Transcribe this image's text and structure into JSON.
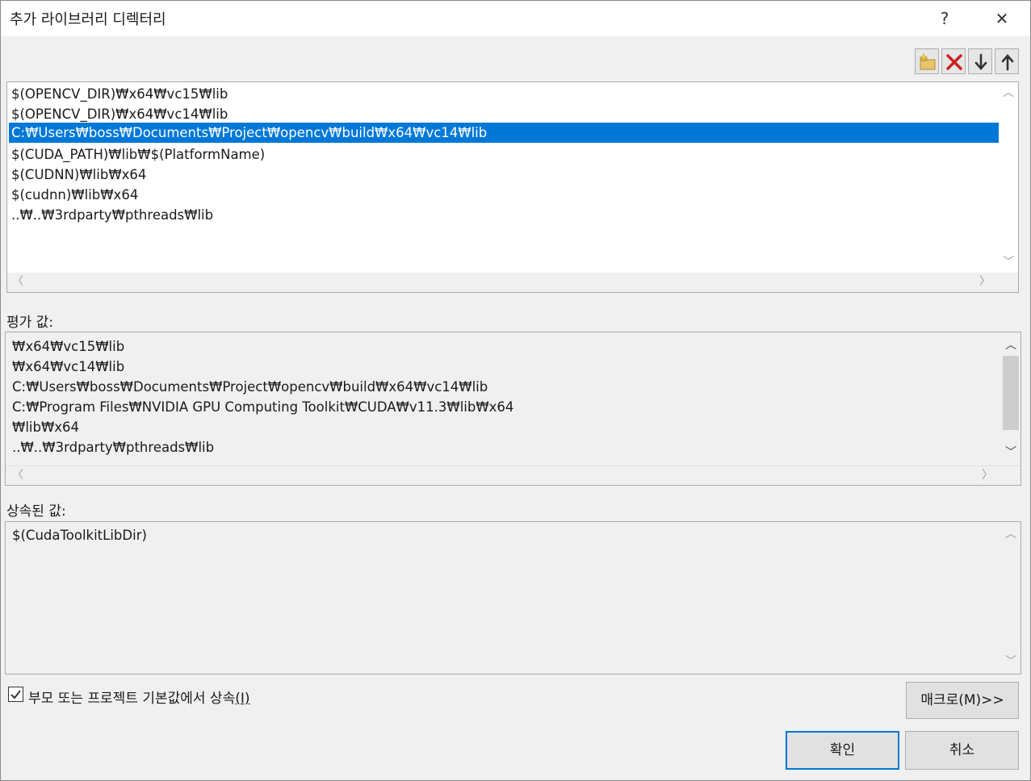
{
  "dialog": {
    "title": "추가 라이브러리 디렉터리",
    "help_glyph": "?",
    "close_glyph": "✕"
  },
  "toolbar": {
    "icons": [
      "new-folder-icon",
      "delete-icon",
      "move-down-icon",
      "move-up-icon"
    ]
  },
  "directory_list": {
    "items": [
      "$(OPENCV_DIR)₩x64₩vc15₩lib",
      "$(OPENCV_DIR)₩x64₩vc14₩lib",
      "C:₩Users₩boss₩Documents₩Project₩opencv₩build₩x64₩vc14₩lib",
      "$(CUDA_PATH)₩lib₩$(PlatformName)",
      "$(CUDNN)₩lib₩x64",
      "$(cudnn)₩lib₩x64",
      "..₩..₩3rdparty₩pthreads₩lib"
    ],
    "selected_index": 2
  },
  "evaluated": {
    "label": "평가 값:",
    "items": [
      "₩x64₩vc15₩lib",
      "₩x64₩vc14₩lib",
      "C:₩Users₩boss₩Documents₩Project₩opencv₩build₩x64₩vc14₩lib",
      "C:₩Program Files₩NVIDIA GPU Computing Toolkit₩CUDA₩v11.3₩lib₩x64",
      "₩lib₩x64",
      "..₩..₩3rdparty₩pthreads₩lib"
    ]
  },
  "inherited": {
    "label": "상속된 값:",
    "items": [
      "$(CudaToolkitLibDir)"
    ]
  },
  "inherit_checkbox": {
    "label": "부모 또는 프로젝트 기본값에서 상속",
    "mnemonic": "(I)",
    "checked": true
  },
  "buttons": {
    "macros": "매크로(M)>>",
    "ok": "확인",
    "cancel": "취소"
  },
  "scroll_glyphs": {
    "up": "︿",
    "down": "﹀",
    "left": "〈",
    "right": "〉"
  }
}
